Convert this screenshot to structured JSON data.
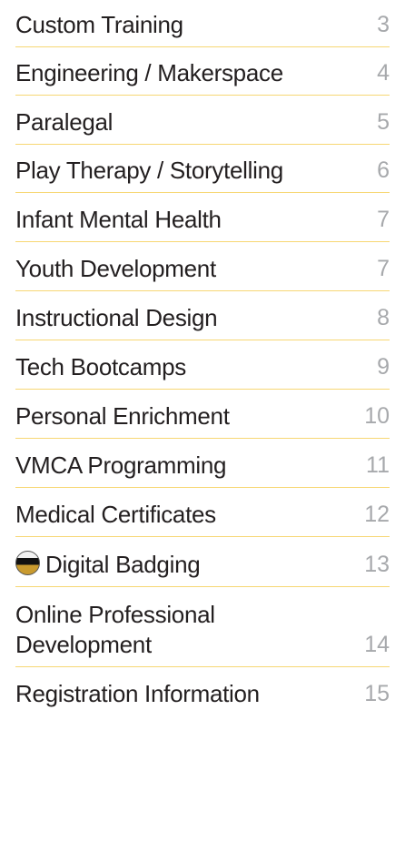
{
  "toc": {
    "entries": [
      {
        "label": "Custom Training",
        "page": "3"
      },
      {
        "label": "Engineering / Makerspace",
        "page": "4"
      },
      {
        "label": "Paralegal",
        "page": "5"
      },
      {
        "label": "Play Therapy / Storytelling",
        "page": "6"
      },
      {
        "label": "Infant Mental Health",
        "page": "7"
      },
      {
        "label": "Youth Development",
        "page": "7"
      },
      {
        "label": "Instructional Design",
        "page": "8"
      },
      {
        "label": "Tech Bootcamps",
        "page": "9"
      },
      {
        "label": "Personal Enrichment",
        "page": "10"
      },
      {
        "label": "VMCA Programming",
        "page": "11"
      },
      {
        "label": "Medical Certificates",
        "page": "12"
      },
      {
        "label": "Digital Badging",
        "page": "13",
        "icon": "vcu-badge-icon"
      },
      {
        "label_line1": "Online Professional",
        "label_line2": "Development",
        "page": "14"
      },
      {
        "label": "Registration Information",
        "page": "15"
      }
    ]
  },
  "colors": {
    "text": "#231f20",
    "page_number": "#a7a9ac",
    "rule": "#f7d774"
  }
}
